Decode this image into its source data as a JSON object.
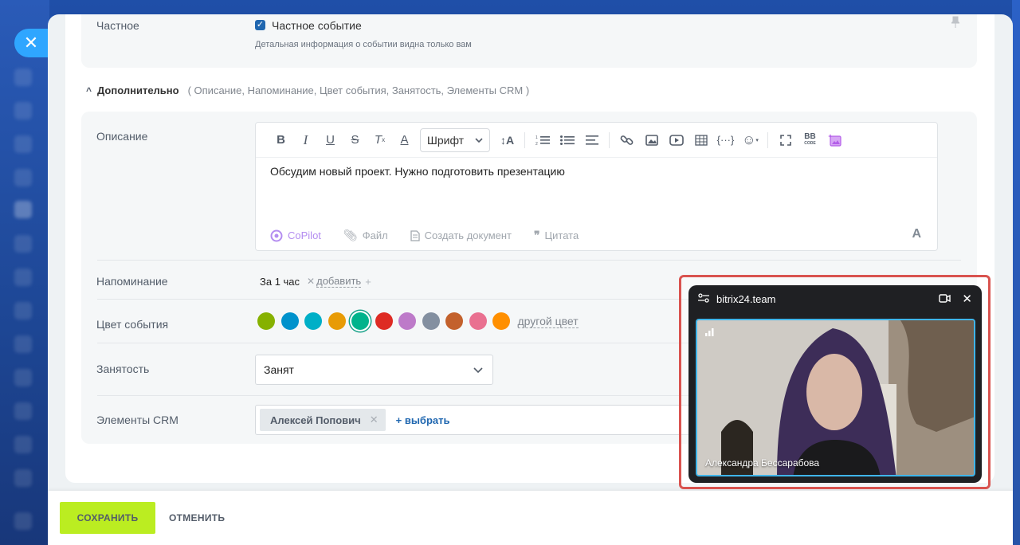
{
  "private": {
    "label": "Частное",
    "checkbox_label": "Частное событие",
    "checked": true,
    "hint": "Детальная информация о событии видна только вам"
  },
  "extra": {
    "title": "Дополнительно",
    "links": "( Описание,  Напоминание,  Цвет события,  Занятость,  Элементы CRM )"
  },
  "description": {
    "label": "Описание",
    "font_select": "Шрифт",
    "text": "Обсудим новый проект. Нужно подготовить презентацию",
    "footer": {
      "copilot": "CoPilot",
      "file": "Файл",
      "create_doc": "Создать документ",
      "quote": "Цитата"
    },
    "format_toggle": "A",
    "toolbar_icons": [
      "bold-icon",
      "italic-icon",
      "underline-icon",
      "strikethrough-icon",
      "clear-format-icon",
      "text-color-icon",
      "font-select",
      "font-size-icon",
      "numbered-list-icon",
      "bullet-list-icon",
      "align-icon",
      "link-icon",
      "image-icon",
      "video-icon",
      "table-icon",
      "code-icon",
      "emoji-icon",
      "fullscreen-icon",
      "bbcode-icon",
      "ai-image-icon"
    ]
  },
  "reminder": {
    "label": "Напоминание",
    "value": "За 1 час",
    "add": "добавить"
  },
  "color": {
    "label": "Цвет события",
    "swatches": [
      "#86b100",
      "#0092cc",
      "#00afc7",
      "#e89b06",
      "#00b38c",
      "#de2b24",
      "#bd7ac9",
      "#838fa0",
      "#c3612c",
      "#e97090",
      "#ff8f00"
    ],
    "selected_index": 4,
    "other": "другой цвет"
  },
  "availability": {
    "label": "Занятость",
    "value": "Занят"
  },
  "crm": {
    "label": "Элементы CRM",
    "tag": "Алексей Попович",
    "add": "+ выбрать"
  },
  "buttons": {
    "save": "СОХРАНИТЬ",
    "cancel": "ОТМЕНИТЬ"
  },
  "video": {
    "title": "bitrix24.team",
    "participant": "Александра Бессарабова",
    "highlight_color": "#d9534f",
    "frame_color": "#3fb5ea"
  },
  "colors": {
    "accent": "#2fa6ff",
    "save_button": "#bbed21",
    "link": "#2067b0"
  }
}
